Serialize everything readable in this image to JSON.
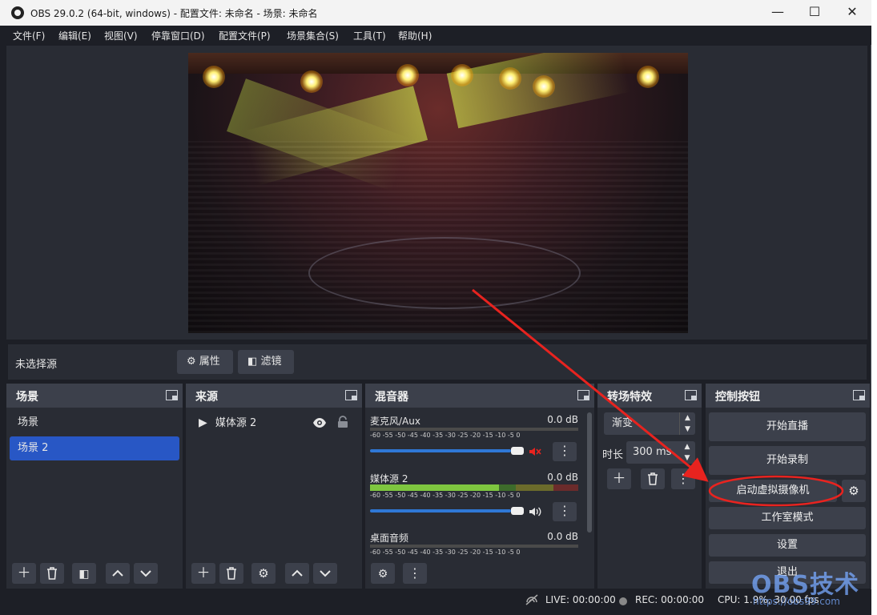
{
  "titlebar": {
    "title": "OBS 29.0.2 (64-bit, windows) - 配置文件: 未命名 - 场景: 未命名",
    "minimize": "—",
    "maximize": "☐",
    "close": "✕"
  },
  "menu": [
    "文件(F)",
    "编辑(E)",
    "视图(V)",
    "停靠窗口(D)",
    "配置文件(P)",
    "场景集合(S)",
    "工具(T)",
    "帮助(H)"
  ],
  "context": {
    "no_source": "未选择源",
    "properties": "属性",
    "filters": "滤镜"
  },
  "scenes": {
    "title": "场景",
    "items": [
      "场景",
      "场景 2"
    ],
    "selected_index": 1
  },
  "sources": {
    "title": "来源",
    "items": [
      "媒体源 2"
    ]
  },
  "mixer": {
    "title": "混音器",
    "scale": [
      "-60",
      "-55",
      "-50",
      "-45",
      "-40",
      "-35",
      "-30",
      "-25",
      "-20",
      "-15",
      "-10",
      "-5",
      "0"
    ],
    "channels": [
      {
        "name": "麦克风/Aux",
        "db": "0.0 dB",
        "muted": true,
        "level": 0.0
      },
      {
        "name": "媒体源 2",
        "db": "0.0 dB",
        "muted": false,
        "level": 0.62
      },
      {
        "name": "桌面音频",
        "db": "0.0 dB",
        "muted": false,
        "level": 0.0
      }
    ]
  },
  "transitions": {
    "title": "转场特效",
    "type": "渐变",
    "duration_label": "时长",
    "duration": "300 ms"
  },
  "controls": {
    "title": "控制按钮",
    "start_stream": "开始直播",
    "start_record": "开始录制",
    "start_virtualcam": "启动虚拟摄像机",
    "studio_mode": "工作室模式",
    "settings": "设置",
    "exit": "退出"
  },
  "status": {
    "live": "LIVE: 00:00:00",
    "rec": "REC: 00:00:00",
    "cpu": "CPU: 1.9%, 30.00 fps"
  },
  "watermark": {
    "brand": "OBS技术",
    "url": "https://obs99.com"
  },
  "colors": {
    "accent": "#2857c5",
    "annotation": "#e8231f",
    "bg": "#1d1f26",
    "panel": "#292c34",
    "button": "#3c404b"
  }
}
